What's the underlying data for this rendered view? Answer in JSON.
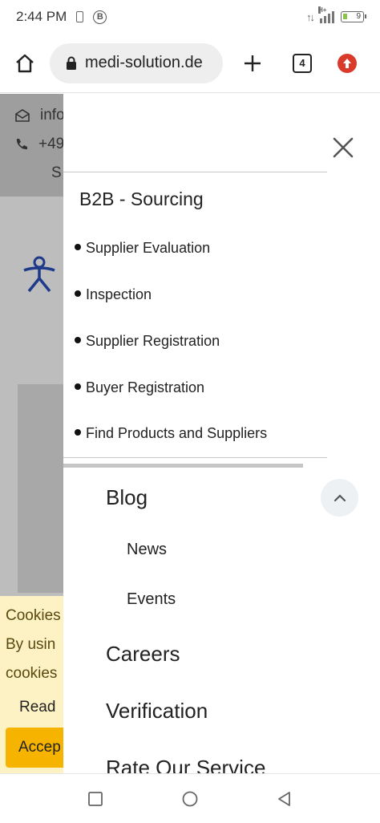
{
  "status_bar": {
    "time": "2:44 PM",
    "b_icon_letter": "B",
    "network_label": "H+",
    "battery": "9"
  },
  "browser": {
    "url": "medi-solution.de",
    "tab_count": "4",
    "icons": {
      "home": "home-icon",
      "lock": "lock-icon",
      "new_tab": "plus-icon",
      "tabs": "tabs-icon",
      "update": "update-arrow-icon"
    },
    "update_color": "#d93a2b"
  },
  "background_page": {
    "contact_email_partial": "info",
    "contact_phone_partial": "+49",
    "letter_s": "S",
    "cookie_lines": [
      "Cookies",
      "By usin",
      "cookies"
    ],
    "cookie_read": "Read",
    "cookie_accept": "Accep",
    "accent_color": "#f6b400"
  },
  "menu": {
    "section_title": "B2B - Sourcing",
    "sub_items": [
      "Supplier Evaluation",
      "Inspection",
      "Supplier Registration",
      "Buyer Registration",
      "Find Products and Suppliers"
    ],
    "blog": {
      "label": "Blog",
      "children": [
        "News",
        "Events"
      ]
    },
    "main_items": [
      "Careers",
      "Verification",
      "Rate Our Service"
    ]
  },
  "nav_bar": {
    "icons": [
      "recents-square-icon",
      "home-circle-icon",
      "back-triangle-icon"
    ]
  }
}
